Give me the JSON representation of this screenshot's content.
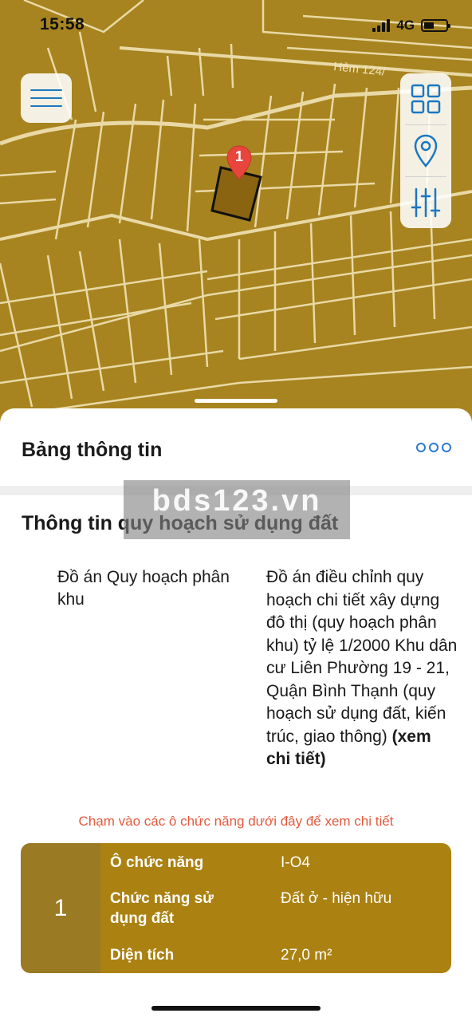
{
  "status_bar": {
    "time": "15:58",
    "network": "4G",
    "signal_icon": "signal-bars-icon",
    "battery_icon": "battery-icon"
  },
  "map": {
    "street_label": "Hẻm 124/",
    "marker_number": "1",
    "colors": {
      "ground": "#a7841f",
      "lines": "#e9d9a6",
      "selected_parcel": "#8a6410",
      "marker": "#e8453c"
    },
    "buttons": {
      "menu_icon": "hamburger-menu-icon",
      "layers_icon": "grid-layers-icon",
      "location_icon": "location-pin-icon",
      "filter_icon": "sliders-icon"
    }
  },
  "sheet": {
    "title": "Bảng thông tin",
    "more_icon": "more-dots-icon",
    "section_title": "Thông tin quy hoạch sử dụng đất",
    "watermark": "bds123.vn",
    "plan_label": "Đồ án Quy hoạch phân khu",
    "plan_value": "Đồ án điều chỉnh quy hoạch chi tiết xây dựng đô thị (quy hoạch phân khu) tỷ lệ 1/2000  Khu dân cư Liên Phường 19 - 21, Quận Bình Thạnh (quy hoạch sử dụng đất, kiến trúc, giao thông)",
    "plan_link": "(xem chi tiết)",
    "hint": "Chạm vào các ô chức năng dưới đây để xem chi tiết",
    "card": {
      "index": "1",
      "rows": [
        {
          "label": "Ô chức năng",
          "value": "I-O4"
        },
        {
          "label": "Chức năng sử dụng đất",
          "value": "Đất ở - hiện hữu"
        },
        {
          "label": "Diện tích",
          "value": "27,0 m²"
        }
      ],
      "colors": {
        "index_bg": "#9a7a22",
        "body_bg": "#ab8111"
      }
    }
  }
}
